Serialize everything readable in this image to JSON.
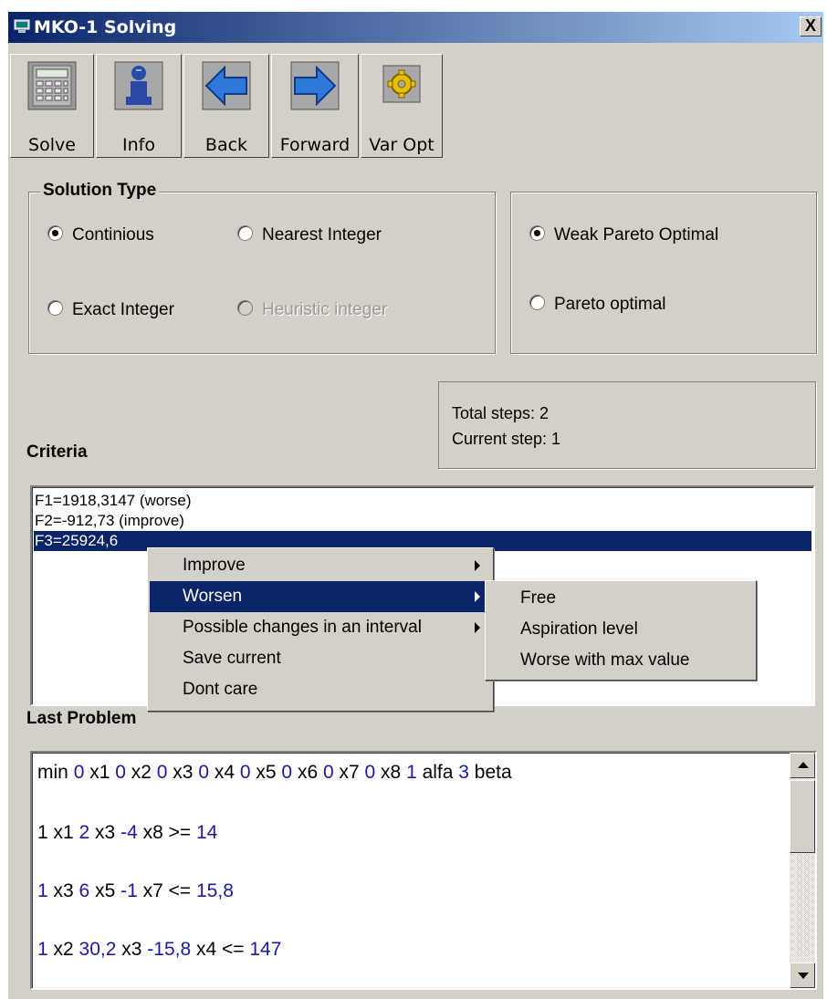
{
  "window": {
    "title": "MKO-1 Solving",
    "close_label": "X"
  },
  "toolbar": [
    {
      "label": "Solve",
      "icon": "calculator-icon"
    },
    {
      "label": "Info",
      "icon": "person-info-icon"
    },
    {
      "label": "Back",
      "icon": "arrow-left-icon"
    },
    {
      "label": "Forward",
      "icon": "arrow-right-icon"
    },
    {
      "label": "Var Opt",
      "icon": "gear-icon"
    }
  ],
  "solution_type": {
    "title": "Solution Type",
    "options": [
      {
        "label": "Continious",
        "selected": true,
        "enabled": true
      },
      {
        "label": "Nearest Integer",
        "selected": false,
        "enabled": true
      },
      {
        "label": "Exact Integer",
        "selected": false,
        "enabled": true
      },
      {
        "label": "Heuristic integer",
        "selected": false,
        "enabled": false
      }
    ]
  },
  "pareto": {
    "options": [
      {
        "label": "Weak Pareto Optimal",
        "selected": true
      },
      {
        "label": "Pareto optimal",
        "selected": false
      }
    ]
  },
  "steps": {
    "total": "Total steps: 2",
    "current": "Current step: 1"
  },
  "criteria": {
    "label": "Criteria",
    "items": [
      {
        "text": "F1=1918,3147 (worse)",
        "selected": false
      },
      {
        "text": "F2=-912,73 (improve)",
        "selected": false
      },
      {
        "text": "F3=25924,6",
        "selected": true
      }
    ]
  },
  "context_menu": {
    "items": [
      {
        "label": "Improve",
        "submenu": true,
        "highlighted": false
      },
      {
        "label": "Worsen",
        "submenu": true,
        "highlighted": true
      },
      {
        "label": "Possible changes in an interval",
        "submenu": true,
        "highlighted": false
      },
      {
        "label": "Save current",
        "submenu": false,
        "highlighted": false
      },
      {
        "label": "Dont care",
        "submenu": false,
        "highlighted": false
      }
    ],
    "submenu": [
      "Free",
      "Aspiration level",
      "Worse with max value"
    ]
  },
  "last_problem": {
    "label": "Last Problem",
    "lines": [
      [
        [
          "t",
          "min "
        ],
        [
          "n",
          "0"
        ],
        [
          "t",
          " x1 "
        ],
        [
          "n",
          "0"
        ],
        [
          "t",
          " x2 "
        ],
        [
          "n",
          "0"
        ],
        [
          "t",
          " x3 "
        ],
        [
          "n",
          "0"
        ],
        [
          "t",
          " x4 "
        ],
        [
          "n",
          "0"
        ],
        [
          "t",
          " x5 "
        ],
        [
          "n",
          "0"
        ],
        [
          "t",
          " x6 "
        ],
        [
          "n",
          "0"
        ],
        [
          "t",
          " x7 "
        ],
        [
          "n",
          "0"
        ],
        [
          "t",
          " x8 "
        ],
        [
          "n",
          "1"
        ],
        [
          "t",
          " alfa "
        ],
        [
          "n",
          "3"
        ],
        [
          "t",
          " beta"
        ]
      ],
      [
        [
          "t",
          "1 x1 "
        ],
        [
          "n",
          "2"
        ],
        [
          "t",
          " x3 "
        ],
        [
          "n",
          "-4"
        ],
        [
          "t",
          " x8 >= "
        ],
        [
          "n",
          "14"
        ]
      ],
      [
        [
          "n",
          "1"
        ],
        [
          "t",
          " x3 "
        ],
        [
          "n",
          "6"
        ],
        [
          "t",
          " x5 "
        ],
        [
          "n",
          "-1"
        ],
        [
          "t",
          " x7 <= "
        ],
        [
          "n",
          "15,8"
        ]
      ],
      [
        [
          "n",
          "1"
        ],
        [
          "t",
          " x2 "
        ],
        [
          "n",
          "30,2"
        ],
        [
          "t",
          " x3 "
        ],
        [
          "n",
          "-15,8"
        ],
        [
          "t",
          " x4 <= "
        ],
        [
          "n",
          "147"
        ]
      ]
    ]
  }
}
